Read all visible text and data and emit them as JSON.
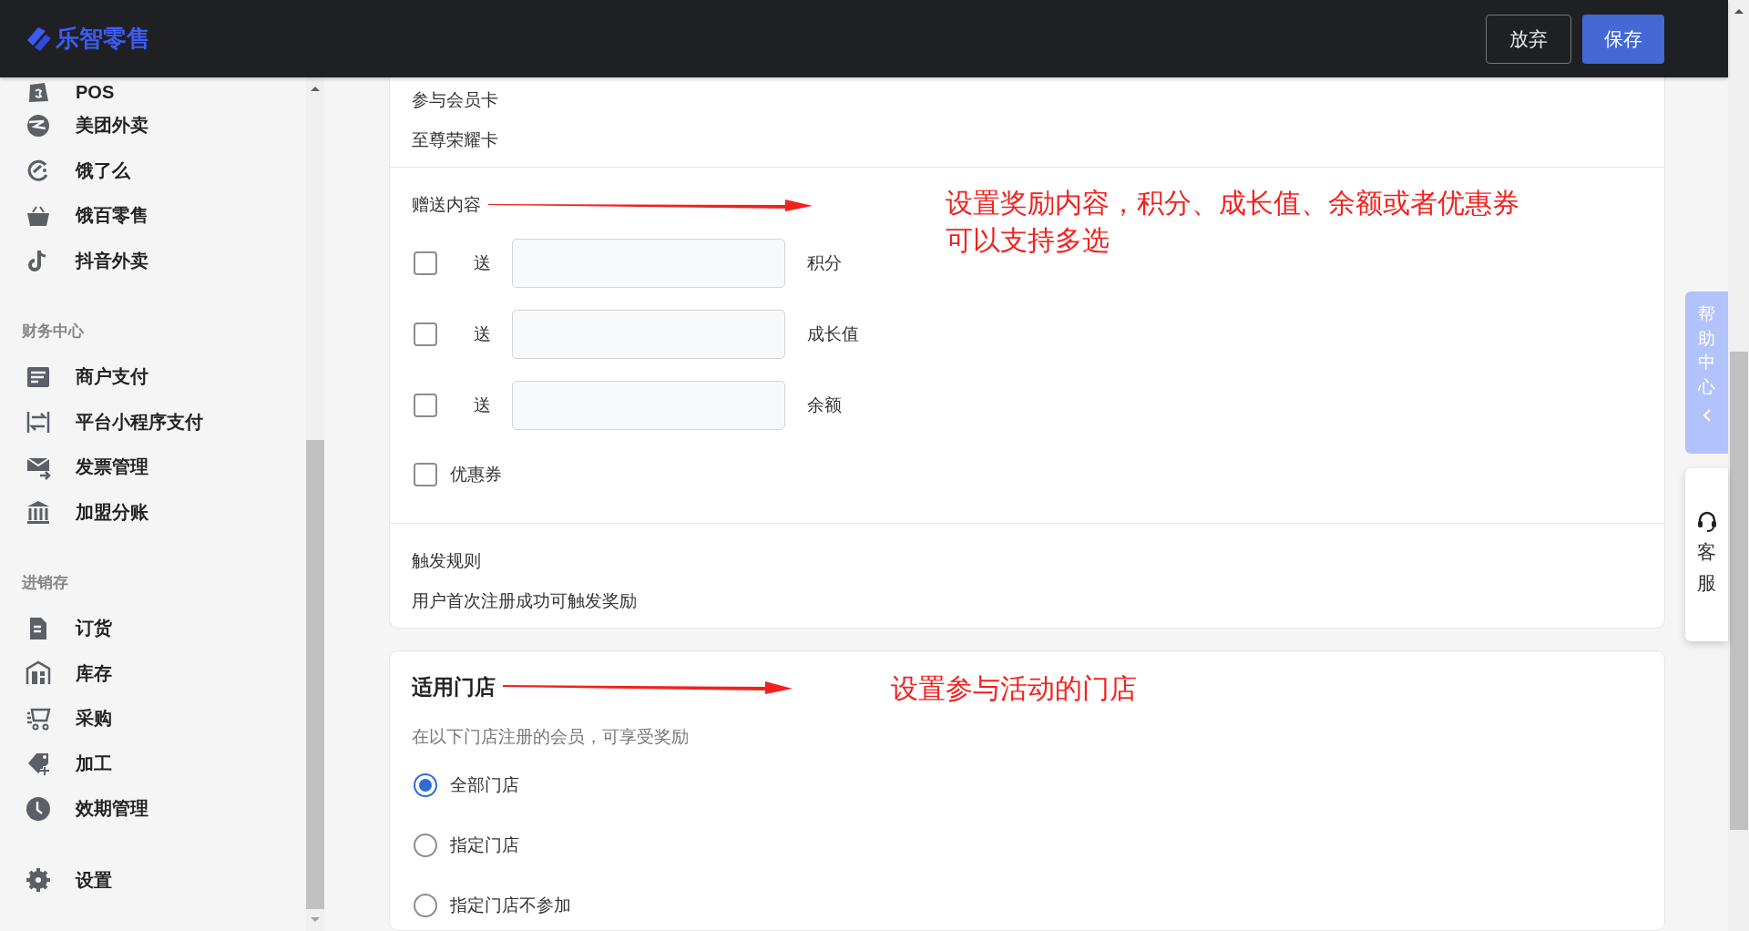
{
  "header": {
    "logo": "乐智零售",
    "buttons": [
      {
        "label": "放弃",
        "kind": "secondary"
      },
      {
        "label": "保存",
        "kind": "primary"
      }
    ]
  },
  "sidebar": {
    "sections": [
      {
        "items": [
          {
            "label": "POS"
          },
          {
            "label": "美团外卖"
          },
          {
            "label": "饿了么"
          },
          {
            "label": "饿百零售"
          },
          {
            "label": "抖音外卖"
          }
        ]
      },
      {
        "title": "财务中心",
        "items": [
          {
            "label": "商户支付"
          },
          {
            "label": "平台小程序支付"
          },
          {
            "label": "发票管理"
          },
          {
            "label": "加盟分账"
          }
        ]
      },
      {
        "title": "进销存",
        "items": [
          {
            "label": "订货"
          },
          {
            "label": "库存"
          },
          {
            "label": "采购"
          },
          {
            "label": "加工"
          },
          {
            "label": "效期管理"
          }
        ]
      },
      {
        "items": [
          {
            "label": "设置"
          }
        ]
      }
    ]
  },
  "member_cards": {
    "label": "参与会员卡",
    "value": "至尊荣耀卡"
  },
  "gifts": {
    "label": "赠送内容",
    "options": [
      {
        "kind": "amount",
        "checked": false,
        "prefix": "送",
        "unit": "积分"
      },
      {
        "kind": "amount",
        "checked": false,
        "prefix": "送",
        "unit": "成长值"
      },
      {
        "kind": "amount",
        "checked": false,
        "prefix": "送",
        "unit": "余额"
      },
      {
        "kind": "plain",
        "checked": false,
        "label": "优惠券"
      }
    ]
  },
  "trigger": {
    "label": "触发规则",
    "value": "用户首次注册成功可触发奖励"
  },
  "stores": {
    "title": "适用门店",
    "hint": "在以下门店注册的会员，可享受奖励",
    "options": [
      {
        "label": "全部门店",
        "selected": true
      },
      {
        "label": "指定门店",
        "selected": false
      },
      {
        "label": "指定门店不参加",
        "selected": false
      }
    ]
  },
  "annotations": [
    {
      "lines": [
        "设置奖励内容，积分、成长值、余额或者优惠券",
        "可以支持多选"
      ]
    },
    {
      "lines": [
        "设置参与活动的门店"
      ]
    }
  ],
  "help": {
    "label": "帮助中心"
  },
  "service": {
    "label": "客服"
  }
}
